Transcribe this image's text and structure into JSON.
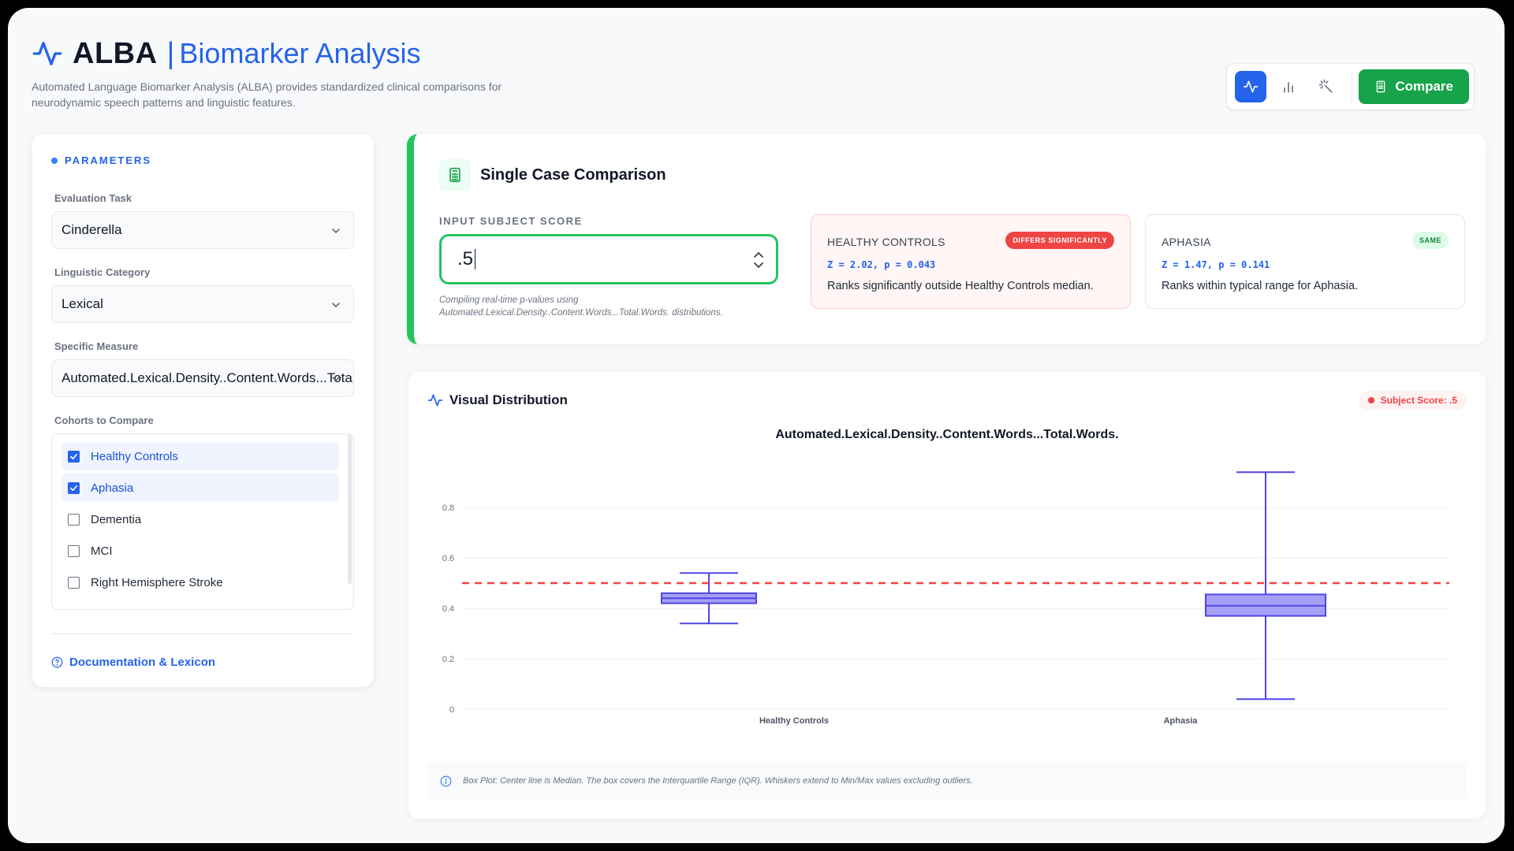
{
  "header": {
    "brand": "ALBA",
    "separator": "|",
    "product": "Biomarker Analysis",
    "subtitle": "Automated Language Biomarker Analysis (ALBA) provides standardized clinical comparisons for neurodynamic speech patterns and linguistic features.",
    "compare_label": "Compare",
    "accent": "#2563eb",
    "success": "#16a34a"
  },
  "sidebar": {
    "title": "PARAMETERS",
    "task_label": "Evaluation Task",
    "task_value": "Cinderella",
    "category_label": "Linguistic Category",
    "category_value": "Lexical",
    "measure_label": "Specific Measure",
    "measure_value": "Automated.Lexical.Density..Content.Words...Total.Words.",
    "cohorts_label": "Cohorts to Compare",
    "cohorts": [
      {
        "label": "Healthy Controls",
        "checked": true
      },
      {
        "label": "Aphasia",
        "checked": true
      },
      {
        "label": "Dementia",
        "checked": false
      },
      {
        "label": "MCI",
        "checked": false
      },
      {
        "label": "Right Hemisphere Stroke",
        "checked": false
      }
    ],
    "doc_link": "Documentation & Lexicon"
  },
  "comparison": {
    "title": "Single Case Comparison",
    "input_label": "INPUT SUBJECT SCORE",
    "input_value": ".5",
    "hint": "Compiling real-time p-values using Automated.Lexical.Density..Content.Words...Total.Words. distributions.",
    "results": [
      {
        "name": "HEALTHY CONTROLS",
        "badge": "DIFFERS SIGNIFICANTLY",
        "stat": "Z = 2.02, p = 0.043",
        "desc": "Ranks significantly outside Healthy Controls median."
      },
      {
        "name": "APHASIA",
        "badge": "SAME",
        "stat": "Z = 1.47, p = 0.141",
        "desc": "Ranks within typical range for Aphasia."
      }
    ]
  },
  "distribution": {
    "title": "Visual Distribution",
    "subject_badge": "Subject Score: .5",
    "footnote": "Box Plot: Center line is Median. The box covers the Interquartile Range (IQR). Whiskers extend to Min/Max values excluding outliers."
  },
  "chart_data": {
    "type": "box",
    "title": "Automated.Lexical.Density..Content.Words...Total.Words.",
    "categories": [
      "Healthy Controls",
      "Aphasia"
    ],
    "boxes": [
      {
        "name": "Healthy Controls",
        "min": 0.34,
        "q1": 0.42,
        "median": 0.44,
        "q3": 0.46,
        "max": 0.54
      },
      {
        "name": "Aphasia",
        "min": 0.04,
        "q1": 0.37,
        "median": 0.41,
        "q3": 0.455,
        "max": 0.94
      }
    ],
    "reference_line": {
      "value": 0.5,
      "color": "#ef4444",
      "style": "dashed"
    },
    "yticks": [
      0,
      0.2,
      0.4,
      0.6,
      0.8
    ],
    "ytick_labels": [
      "0",
      "0.2",
      "0.4",
      "0.6",
      "0.8"
    ],
    "ylim": [
      0,
      0.96
    ],
    "box_color": "#a5a0f5",
    "line_color": "#4f46e5",
    "grid": true
  }
}
